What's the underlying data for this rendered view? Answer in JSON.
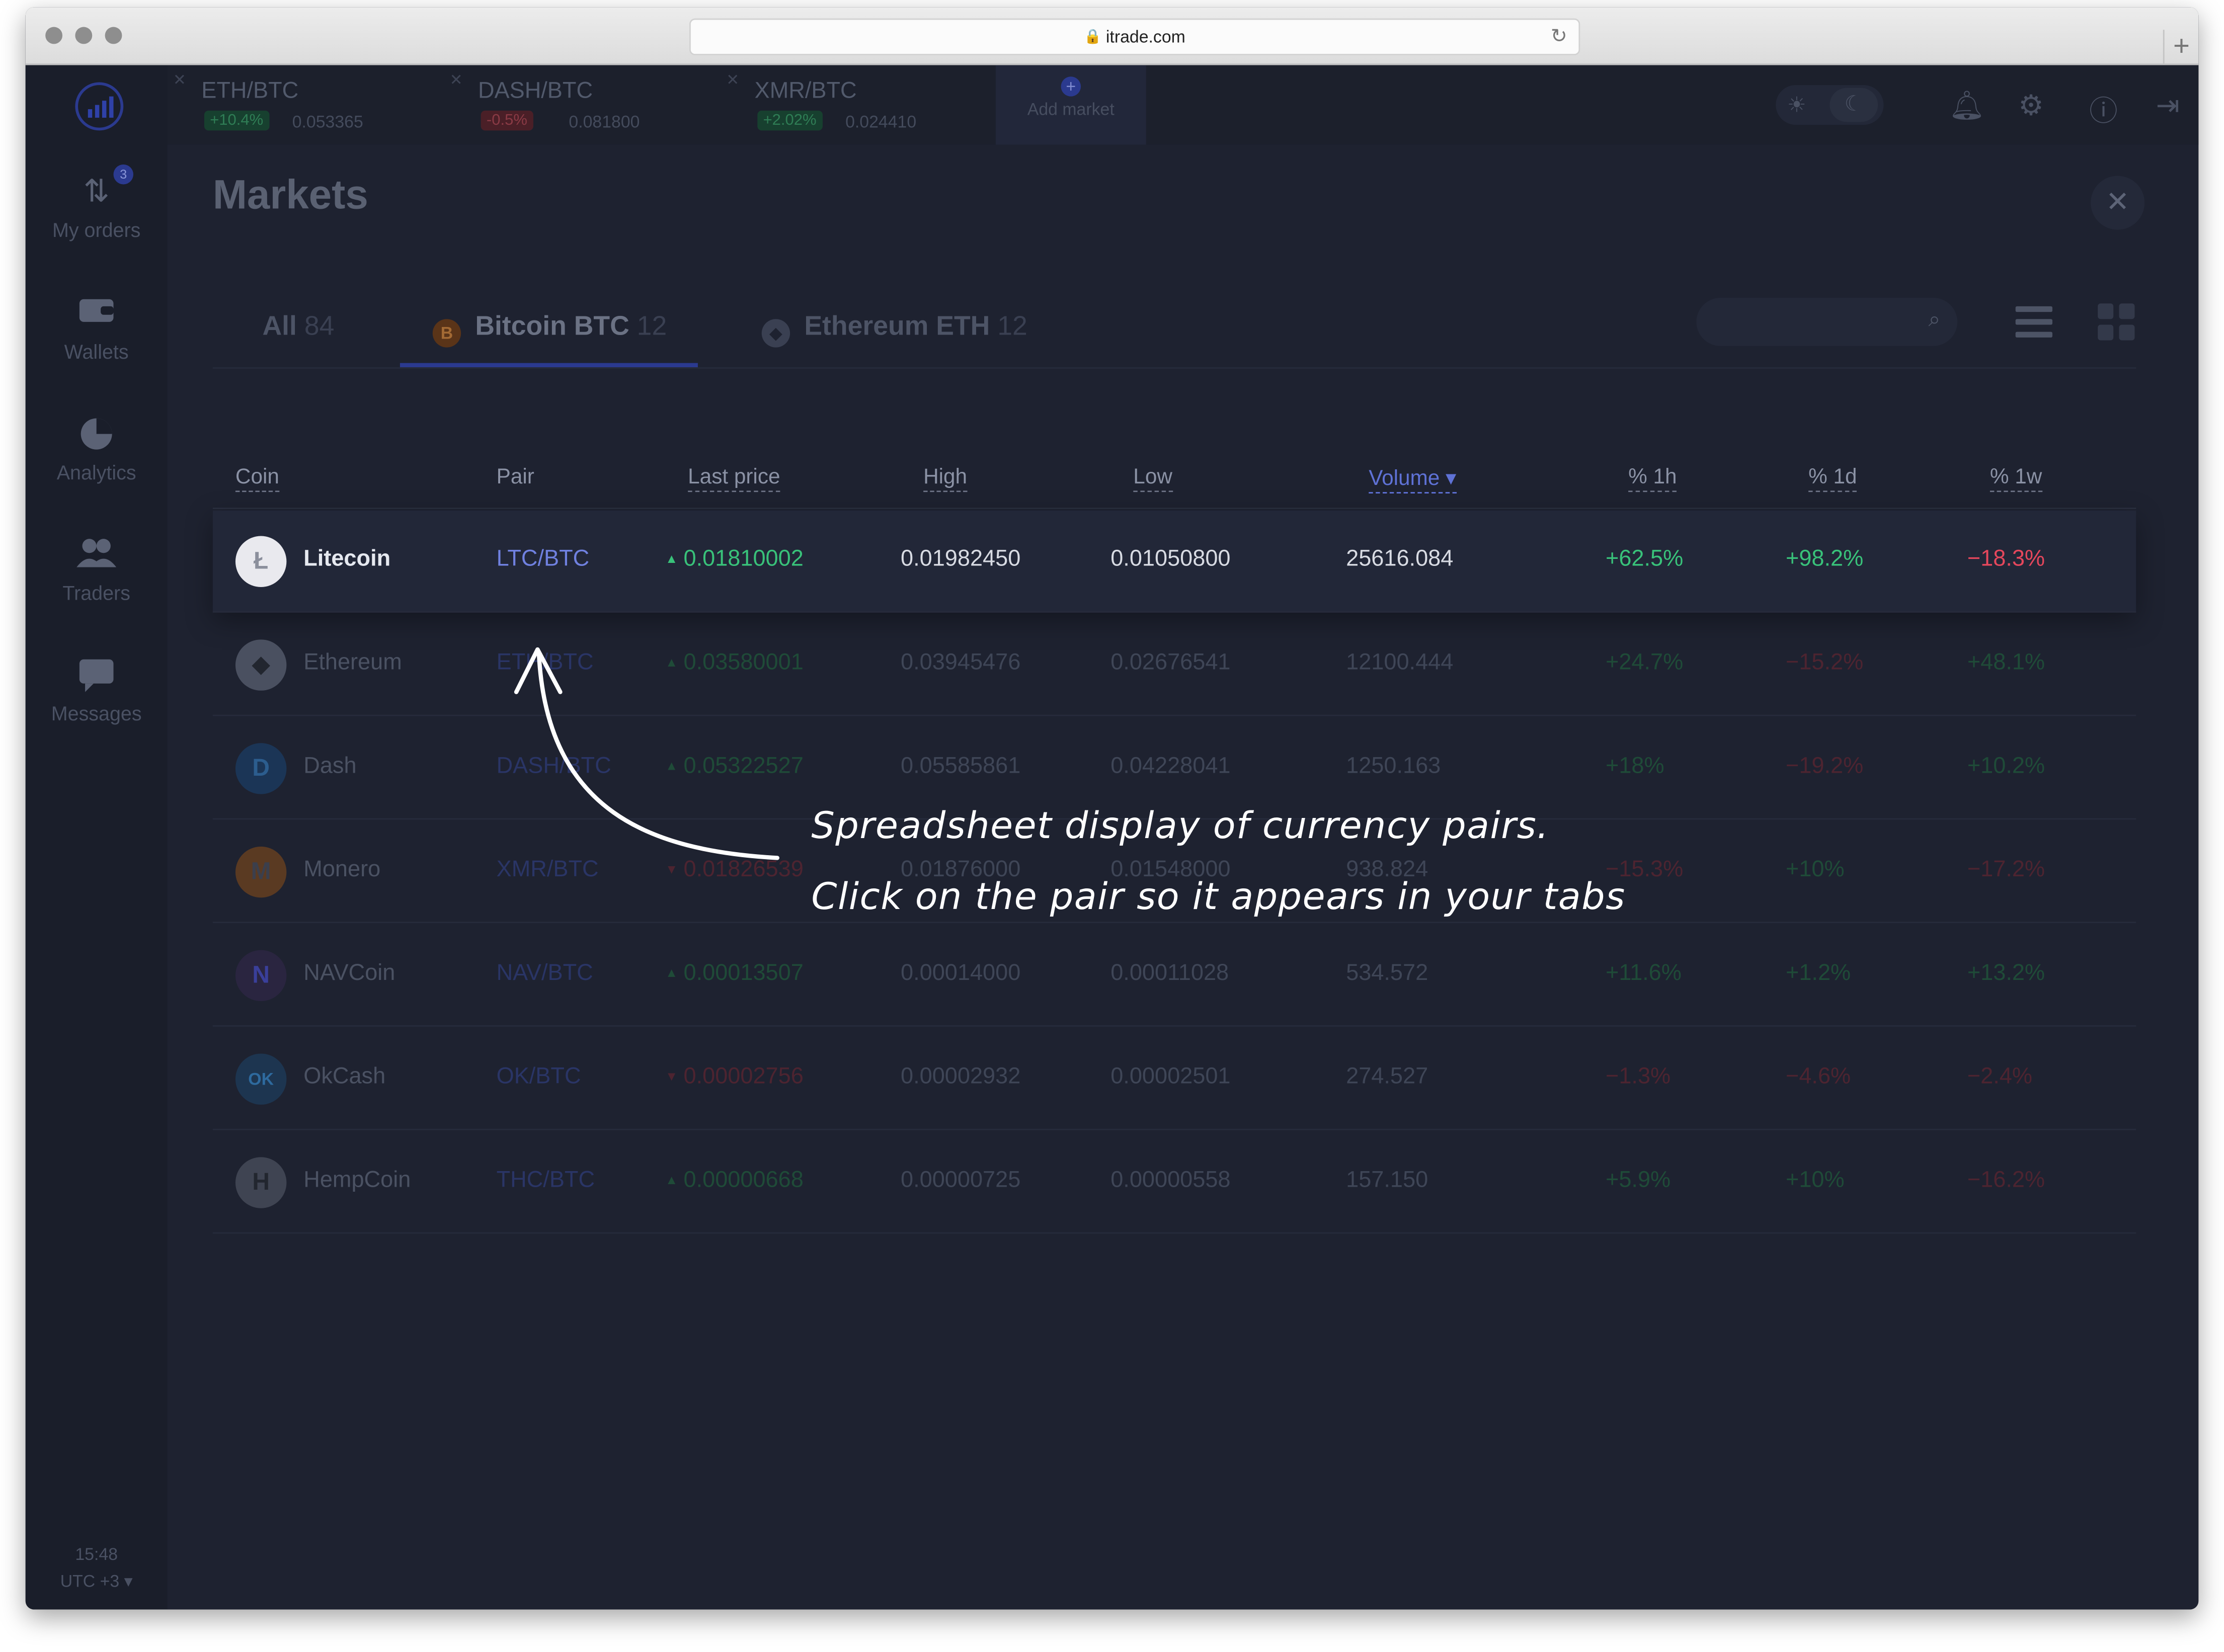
{
  "browser": {
    "url": "itrade.com"
  },
  "sidebar": {
    "items": [
      {
        "label": "My orders",
        "icon": "orders-arrows-icon",
        "badge": "3"
      },
      {
        "label": "Wallets",
        "icon": "wallet-icon"
      },
      {
        "label": "Analytics",
        "icon": "pie-chart-icon"
      },
      {
        "label": "Traders",
        "icon": "people-icon"
      },
      {
        "label": "Messages",
        "icon": "chat-bubble-icon"
      }
    ],
    "time": "15:48",
    "timezone": "UTC +3 ▾"
  },
  "market_tabs": [
    {
      "pair": "ETH/BTC",
      "change": "+10.4%",
      "direction": "up",
      "price": "0.053365"
    },
    {
      "pair": "DASH/BTC",
      "change": "-0.5%",
      "direction": "down",
      "price": "0.081800"
    },
    {
      "pair": "XMR/BTC",
      "change": "+2.02%",
      "direction": "up",
      "price": "0.024410"
    }
  ],
  "add_market_label": "Add market",
  "page": {
    "title": "Markets"
  },
  "filter_tabs": [
    {
      "label": "All",
      "count": "84"
    },
    {
      "label": "Bitcoin BTC",
      "count": "12",
      "icon": "bitcoin-icon"
    },
    {
      "label": "Ethereum ETH",
      "count": "12",
      "icon": "ethereum-icon"
    }
  ],
  "search": {
    "placeholder": ""
  },
  "table": {
    "headers": {
      "coin": "Coin",
      "pair": "Pair",
      "last_price": "Last price",
      "high": "High",
      "low": "Low",
      "volume": "Volume ▾",
      "h1": "% 1h",
      "d1": "% 1d",
      "w1": "% 1w"
    },
    "rows": [
      {
        "coin": "Litecoin",
        "pair": "LTC/BTC",
        "last_price": "0.01810002",
        "price_dir": "up",
        "high": "0.01982450",
        "low": "0.01050800",
        "volume": "25616.084",
        "h1": "+62.5%",
        "d1": "+98.2%",
        "w1": "−18.3%"
      },
      {
        "coin": "Ethereum",
        "pair": "ETH/BTC",
        "last_price": "0.03580001",
        "price_dir": "up",
        "high": "0.03945476",
        "low": "0.02676541",
        "volume": "12100.444",
        "h1": "+24.7%",
        "d1": "−15.2%",
        "w1": "+48.1%"
      },
      {
        "coin": "Dash",
        "pair": "DASH/BTC",
        "last_price": "0.05322527",
        "price_dir": "up",
        "high": "0.05585861",
        "low": "0.04228041",
        "volume": "1250.163",
        "h1": "+18%",
        "d1": "−19.2%",
        "w1": "+10.2%"
      },
      {
        "coin": "Monero",
        "pair": "XMR/BTC",
        "last_price": "0.01826539",
        "price_dir": "down",
        "high": "0.01876000",
        "low": "0.01548000",
        "volume": "938.824",
        "h1": "−15.3%",
        "d1": "+10%",
        "w1": "−17.2%"
      },
      {
        "coin": "NAVCoin",
        "pair": "NAV/BTC",
        "last_price": "0.00013507",
        "price_dir": "up",
        "high": "0.00014000",
        "low": "0.00011028",
        "volume": "534.572",
        "h1": "+11.6%",
        "d1": "+1.2%",
        "w1": "+13.2%"
      },
      {
        "coin": "OkCash",
        "pair": "OK/BTC",
        "last_price": "0.00002756",
        "price_dir": "down",
        "high": "0.00002932",
        "low": "0.00002501",
        "volume": "274.527",
        "h1": "−1.3%",
        "d1": "−4.6%",
        "w1": "−2.4%"
      },
      {
        "coin": "HempCoin",
        "pair": "THC/BTC",
        "last_price": "0.00000668",
        "price_dir": "up",
        "high": "0.00000725",
        "low": "0.00000558",
        "volume": "157.150",
        "h1": "+5.9%",
        "d1": "+10%",
        "w1": "−16.2%"
      }
    ]
  },
  "annotation": {
    "line1": "Spreadsheet display of currency pairs.",
    "line2": "Click on the pair so it appears in your tabs"
  },
  "colors": {
    "background": "#1e2230",
    "accent": "#5f72d6",
    "positive": "#39c27a",
    "negative": "#e5475c"
  }
}
